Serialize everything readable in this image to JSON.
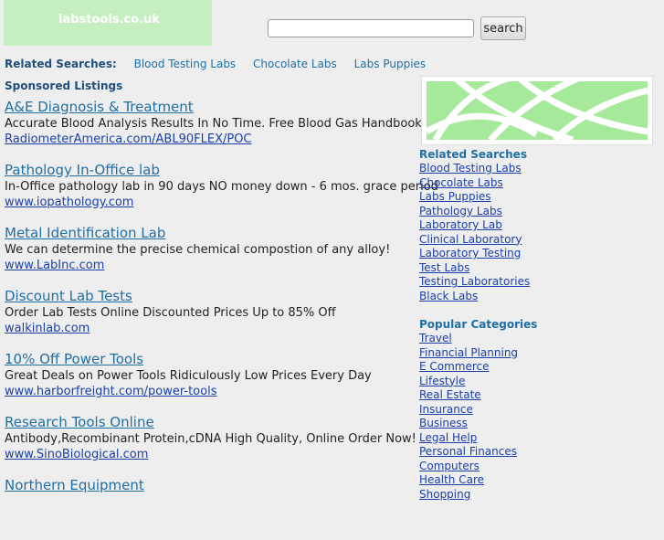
{
  "logo": {
    "text": "labstools.co.uk"
  },
  "search": {
    "value": "",
    "button": "search"
  },
  "related_bar": {
    "label": "Related Searches:",
    "links": [
      "Blood Testing Labs",
      "Chocolate Labs",
      "Labs Puppies"
    ]
  },
  "sponsored_label": "Sponsored Listings",
  "ads": [
    {
      "title": "A&E Diagnosis & Treatment",
      "desc": "Accurate Blood Analysis Results In No Time. Free Blood Gas Handbook.",
      "url": "RadiometerAmerica.com/ABL90FLEX/POC"
    },
    {
      "title": "Pathology In-Office lab",
      "desc": "In-Office pathology lab in 90 days NO money down - 6 mos. grace period",
      "url": "www.iopathology.com"
    },
    {
      "title": "Metal Identification Lab",
      "desc": "We can determine the precise chemical compostion of any alloy!",
      "url": "www.LabInc.com"
    },
    {
      "title": "Discount Lab Tests",
      "desc": "Order Lab Tests Online Discounted Prices Up to 85% Off",
      "url": "walkinlab.com"
    },
    {
      "title": "10% Off Power Tools",
      "desc": "Great Deals on Power Tools Ridiculously Low Prices Every Day",
      "url": "www.harborfreight.com/power-tools"
    },
    {
      "title": "Research Tools Online",
      "desc": "Antibody,Recombinant Protein,cDNA High Quality, Online Order Now!",
      "url": "www.SinoBiological.com"
    },
    {
      "title": "Northern Equipment",
      "desc": "",
      "url": ""
    }
  ],
  "sidebar": {
    "related_title": "Related Searches",
    "related": [
      "Blood Testing Labs",
      "Chocolate Labs",
      "Labs Puppies",
      "Pathology Labs",
      "Laboratory Lab",
      "Clinical Laboratory",
      "Laboratory Testing",
      "Test Labs",
      "Testing Laboratories",
      "Black Labs"
    ],
    "popular_title": "Popular Categories",
    "popular": [
      "Travel",
      "Financial Planning",
      "E Commerce",
      "Lifestyle",
      "Real Estate",
      "Insurance",
      "Business",
      "Legal Help",
      "Personal Finances",
      "Computers",
      "Health Care",
      "Shopping"
    ]
  }
}
